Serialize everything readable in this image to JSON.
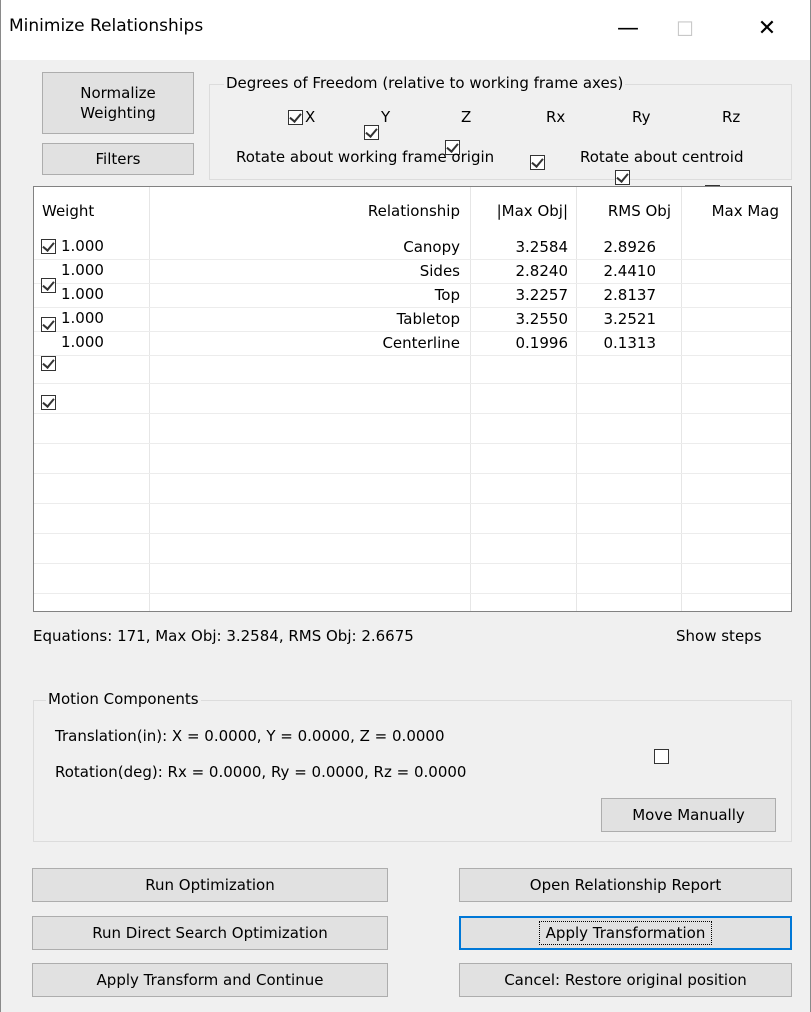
{
  "window": {
    "title": "Minimize Relationships",
    "minimize_glyph": "—",
    "maximize_glyph": "☐",
    "close_glyph": "✕"
  },
  "buttons": {
    "normalize_line1": "Normalize",
    "normalize_line2": "Weighting",
    "filters": "Filters"
  },
  "dof": {
    "legend": "Degrees of Freedom (relative to working frame axes)",
    "axes": [
      {
        "label": "X",
        "checked": true
      },
      {
        "label": "Y",
        "checked": true
      },
      {
        "label": "Z",
        "checked": true
      },
      {
        "label": "Rx",
        "checked": true
      },
      {
        "label": "Ry",
        "checked": true
      },
      {
        "label": "Rz",
        "checked": true
      }
    ],
    "rotate_origin": "Rotate about working frame origin",
    "rotate_centroid": "Rotate about centroid",
    "selected": "centroid"
  },
  "table": {
    "headers": {
      "weight": "Weight",
      "relationship": "Relationship",
      "max_obj": "|Max Obj|",
      "rms_obj": "RMS Obj",
      "max_mag": "Max Mag"
    },
    "rows": [
      {
        "checked": true,
        "weight": "1.000",
        "relationship": "Canopy",
        "max_obj": "3.2584",
        "rms_obj": "2.8926",
        "max_mag": ""
      },
      {
        "checked": true,
        "weight": "1.000",
        "relationship": "Sides",
        "max_obj": "2.8240",
        "rms_obj": "2.4410",
        "max_mag": ""
      },
      {
        "checked": true,
        "weight": "1.000",
        "relationship": "Top",
        "max_obj": "3.2257",
        "rms_obj": "2.8137",
        "max_mag": ""
      },
      {
        "checked": true,
        "weight": "1.000",
        "relationship": "Tabletop",
        "max_obj": "3.2550",
        "rms_obj": "3.2521",
        "max_mag": ""
      },
      {
        "checked": true,
        "weight": "1.000",
        "relationship": "Centerline",
        "max_obj": "0.1996",
        "rms_obj": "0.1313",
        "max_mag": ""
      }
    ]
  },
  "status": {
    "equations": "Equations: 171, Max Obj: 3.2584, RMS Obj: 2.6675",
    "show_steps": "Show steps",
    "show_steps_checked": false
  },
  "motion": {
    "legend": "Motion Components",
    "translation": "Translation(in):  X =  0.0000, Y =  0.0000, Z =  0.0000",
    "rotation": "Rotation(deg):  Rx =  0.0000, Ry =  0.0000, Rz =  0.0000",
    "move_manually": "Move Manually"
  },
  "actions": {
    "run_optimization": "Run Optimization",
    "open_report": "Open Relationship Report",
    "run_direct": "Run Direct Search Optimization",
    "apply_transformation": "Apply Transformation",
    "apply_continue": "Apply Transform and Continue",
    "cancel_restore": "Cancel: Restore original position"
  }
}
